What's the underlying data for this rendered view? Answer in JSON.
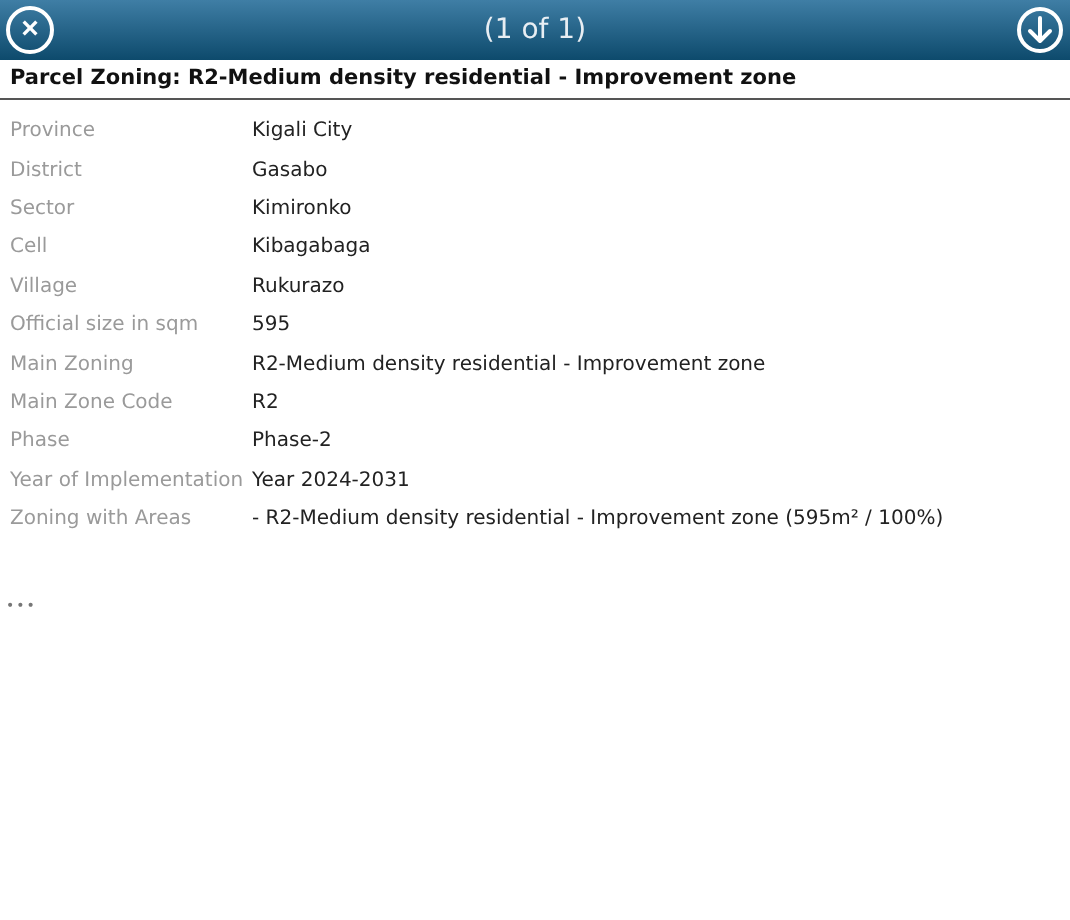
{
  "header": {
    "title": "(1 of 1)",
    "close_symbol": "×"
  },
  "popup_title": "Parcel Zoning: R2-Medium density residential - Improvement zone",
  "fields": [
    {
      "label": "Province",
      "value": "Kigali City"
    },
    {
      "label": "District",
      "value": "Gasabo"
    },
    {
      "label": "Sector",
      "value": "Kimironko"
    },
    {
      "label": "Cell",
      "value": "Kibagabaga"
    },
    {
      "label": "Village",
      "value": "Rukurazo"
    },
    {
      "label": "Official size in sqm",
      "value": "595"
    },
    {
      "label": "Main Zoning",
      "value": "R2-Medium density residential - Improvement zone"
    },
    {
      "label": "Main Zone Code",
      "value": "R2"
    },
    {
      "label": "Phase",
      "value": "Phase-2"
    },
    {
      "label": "Year of Implementation",
      "value": "Year 2024-2031"
    },
    {
      "label": "Zoning with Areas",
      "value": "- R2-Medium density residential - Improvement zone (595m² / 100%)"
    }
  ],
  "more_symbol": "•••"
}
